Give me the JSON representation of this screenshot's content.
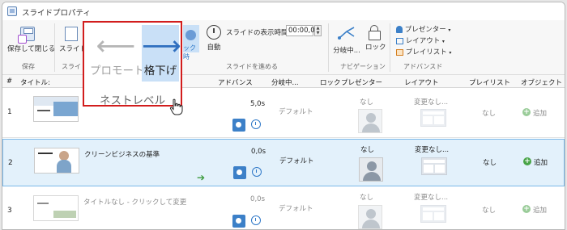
{
  "window": {
    "title": "スライドプロパティ"
  },
  "ribbon": {
    "save_close": "保存して閉じる",
    "group_save": "保存",
    "slide_btn": "スライド",
    "group_slide": "スライド",
    "slide_time_label": "スライドの表示時間:",
    "slide_time_value": "00:00,00",
    "click_label": "ック時",
    "auto_label": "自動",
    "group_advance": "スライドを進める",
    "branch_label": "分岐中...",
    "lock_label": "ロック",
    "group_nav": "ナビゲーション",
    "presenter_label": "プレゼンター",
    "layout_label": "レイアウト",
    "playlist_label": "プレイリスト",
    "group_adv": "アドバンスド"
  },
  "popup": {
    "promote": "プロモート",
    "demote": "格下げ",
    "nest_level": "ネストレベル"
  },
  "table": {
    "headers": [
      "#",
      "タイトル:",
      "アドバンス",
      "分岐中...",
      "ロック",
      "プレゼンター",
      "レイアウト",
      "プレイリスト",
      "オブジェクト"
    ],
    "rows": [
      {
        "num": "1",
        "title": "",
        "advance": "5,0s",
        "branch": "デフォルト",
        "presenter": "なし",
        "layout": "変更なし...",
        "playlist": "なし",
        "object": "追加"
      },
      {
        "num": "2",
        "title": "クリーンビジネスの基準",
        "advance": "0,0s",
        "branch": "デフォルト",
        "presenter": "なし",
        "layout": "変更なし...",
        "playlist": "なし",
        "object": "追加"
      },
      {
        "num": "3",
        "title": "タイトルなし - クリックして変更",
        "advance": "0,0s",
        "branch": "デフォルト",
        "presenter": "なし",
        "layout": "変更なし...",
        "playlist": "なし",
        "object": "追加"
      }
    ]
  },
  "colors": {
    "accent": "#2f78c8",
    "popup_border": "#d21d1d",
    "selected_row": "#e3f1fb"
  }
}
